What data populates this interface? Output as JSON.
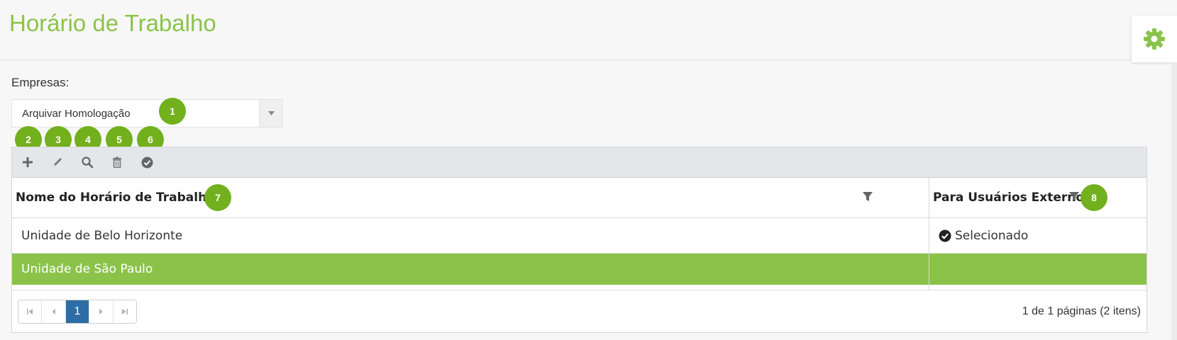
{
  "page": {
    "title": "Horário de Trabalho"
  },
  "icons": {
    "settings": "gear-icon",
    "accent": "#8bc34a",
    "badge_color": "#72b01d",
    "selected_row_color": "#8bc34a",
    "active_page_color": "#2e6da4"
  },
  "company_field": {
    "label": "Empresas:",
    "value": "Arquivar Homologação"
  },
  "badges": [
    "1",
    "2",
    "3",
    "4",
    "5",
    "6",
    "7",
    "8"
  ],
  "toolbar": {
    "items": [
      "add-icon",
      "edit-icon",
      "search-icon",
      "delete-icon",
      "check-circle-icon"
    ]
  },
  "grid": {
    "columns": [
      "Nome do Horário de Trabalho",
      "Para Usuários Externos"
    ],
    "rows": [
      {
        "name": "Unidade de Belo Horizonte",
        "external": "Selecionado"
      },
      {
        "name": "Unidade de São Paulo",
        "external": ""
      }
    ],
    "selected_row": 2
  },
  "pager": {
    "current_page": "1",
    "info": "1 de 1 páginas (2 itens)"
  }
}
